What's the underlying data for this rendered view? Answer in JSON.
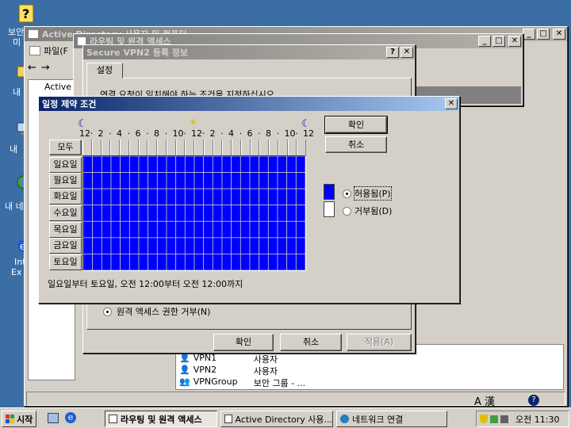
{
  "desktop": {
    "labels": [
      "보안",
      "미",
      "내",
      "내 ",
      "내 네",
      "Int",
      "Ex"
    ]
  },
  "ad_window": {
    "title": "Active Directory 사용자 및 컴퓨터",
    "menu_file": "파일(F",
    "tree_label": "Active",
    "list": [
      {
        "name": "VPN1",
        "type": "사용자"
      },
      {
        "name": "VPN2",
        "type": "사용자"
      },
      {
        "name": "VPNGroup",
        "type": "보안 그룹 - ..."
      }
    ]
  },
  "routing_window": {
    "title": "라우팅 및 원격 액세스"
  },
  "vpn_dialog": {
    "title": "Secure VPN2 등록 정보",
    "tab": "설정",
    "instruction": "연결 요청이 일치해야 하는 조건을 지정하십시오",
    "radio_deny": "원격 액세스 권한 거부(N)",
    "ok": "확인",
    "cancel": "취소",
    "apply": "적용(A)"
  },
  "schedule_dialog": {
    "title": "일정 제약 조건",
    "ok": "확인",
    "cancel": "취소",
    "hours": [
      "12",
      "2",
      "4",
      "6",
      "8",
      "10",
      "12",
      "2",
      "4",
      "6",
      "8",
      "10",
      "12"
    ],
    "all_label": "모두",
    "days": [
      "일요일",
      "월요일",
      "화요일",
      "수요일",
      "목요일",
      "금요일",
      "토요일"
    ],
    "permit": "허용됨(P)",
    "deny": "거부됨(D)",
    "summary": "일요일부터 토요일, 오전 12:00부터 오전 12:00까지",
    "permit_color": "#0000ff"
  },
  "taskbar": {
    "start": "시작",
    "tasks": [
      "라우팅 및 원격 액세스",
      "Active Directory 사용...",
      "네트워크 연결"
    ],
    "clock": "오전 11:30",
    "ime": "A 漢"
  }
}
